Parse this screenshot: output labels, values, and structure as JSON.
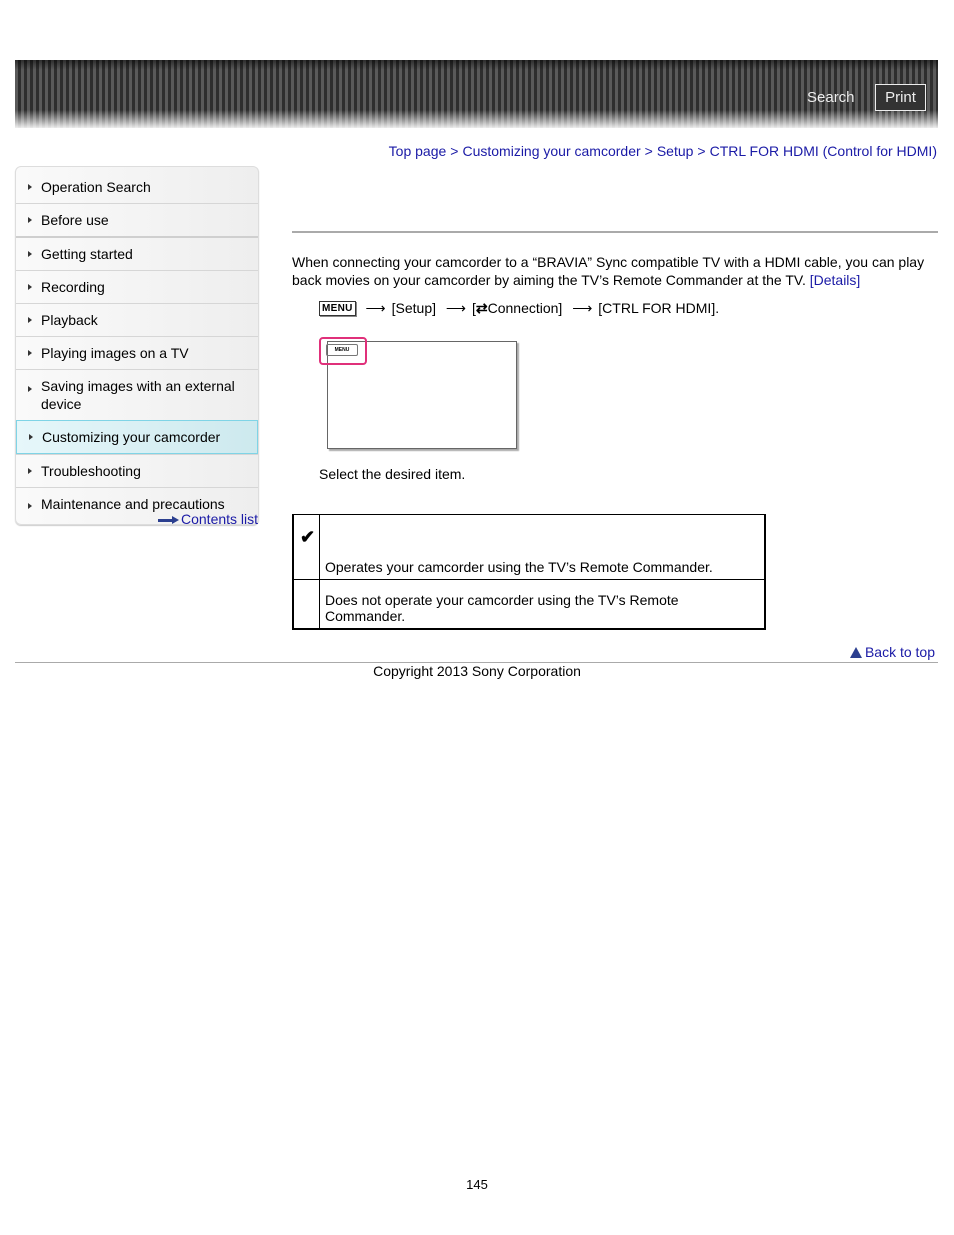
{
  "header": {
    "search_label": "Search",
    "print_label": "Print"
  },
  "breadcrumb": {
    "items": [
      "Top page",
      "Customizing your camcorder",
      "Setup",
      "CTRL FOR HDMI (Control for HDMI)"
    ],
    "separator": ">"
  },
  "sidebar": {
    "items": [
      {
        "label": "Operation Search",
        "active": false
      },
      {
        "label": "Before use",
        "active": false
      },
      {
        "label": "Getting started",
        "active": false
      },
      {
        "label": "Recording",
        "active": false
      },
      {
        "label": "Playback",
        "active": false
      },
      {
        "label": "Playing images on a TV",
        "active": false
      },
      {
        "label": "Saving images with an external device",
        "active": false
      },
      {
        "label": "Customizing your camcorder",
        "active": true
      },
      {
        "label": "Troubleshooting",
        "active": false
      },
      {
        "label": "Maintenance and precautions",
        "active": false
      }
    ],
    "contents_list_label": "Contents list"
  },
  "main": {
    "intro_text": "When connecting your camcorder to a “BRAVIA” Sync compatible TV with a HDMI cable, you can play back movies on your camcorder by aiming the TV’s Remote Commander at the TV.",
    "details_link": "[Details]",
    "steps": {
      "menu_key": "MENU",
      "arrow": "⟶",
      "step1": "[Setup]",
      "step2_prefix": "[",
      "step2_icon": "⇄",
      "step2": "Connection]",
      "step3": "[CTRL FOR HDMI]."
    },
    "screen_menu_label": "MENU",
    "select_text": "Select the desired item.",
    "options": [
      {
        "selected": true,
        "mark": "✔",
        "description": "Operates your camcorder using the TV’s Remote Commander."
      },
      {
        "selected": false,
        "mark": "",
        "description": "Does not operate your camcorder using the TV’s Remote Commander."
      }
    ]
  },
  "footer": {
    "back_to_top": "Back to top",
    "copyright": "Copyright 2013 Sony Corporation",
    "page_number": "145"
  },
  "colors": {
    "link": "#1a1aa6",
    "active_nav_border": "#7fd4e6",
    "highlight_pink": "#e0307a"
  }
}
